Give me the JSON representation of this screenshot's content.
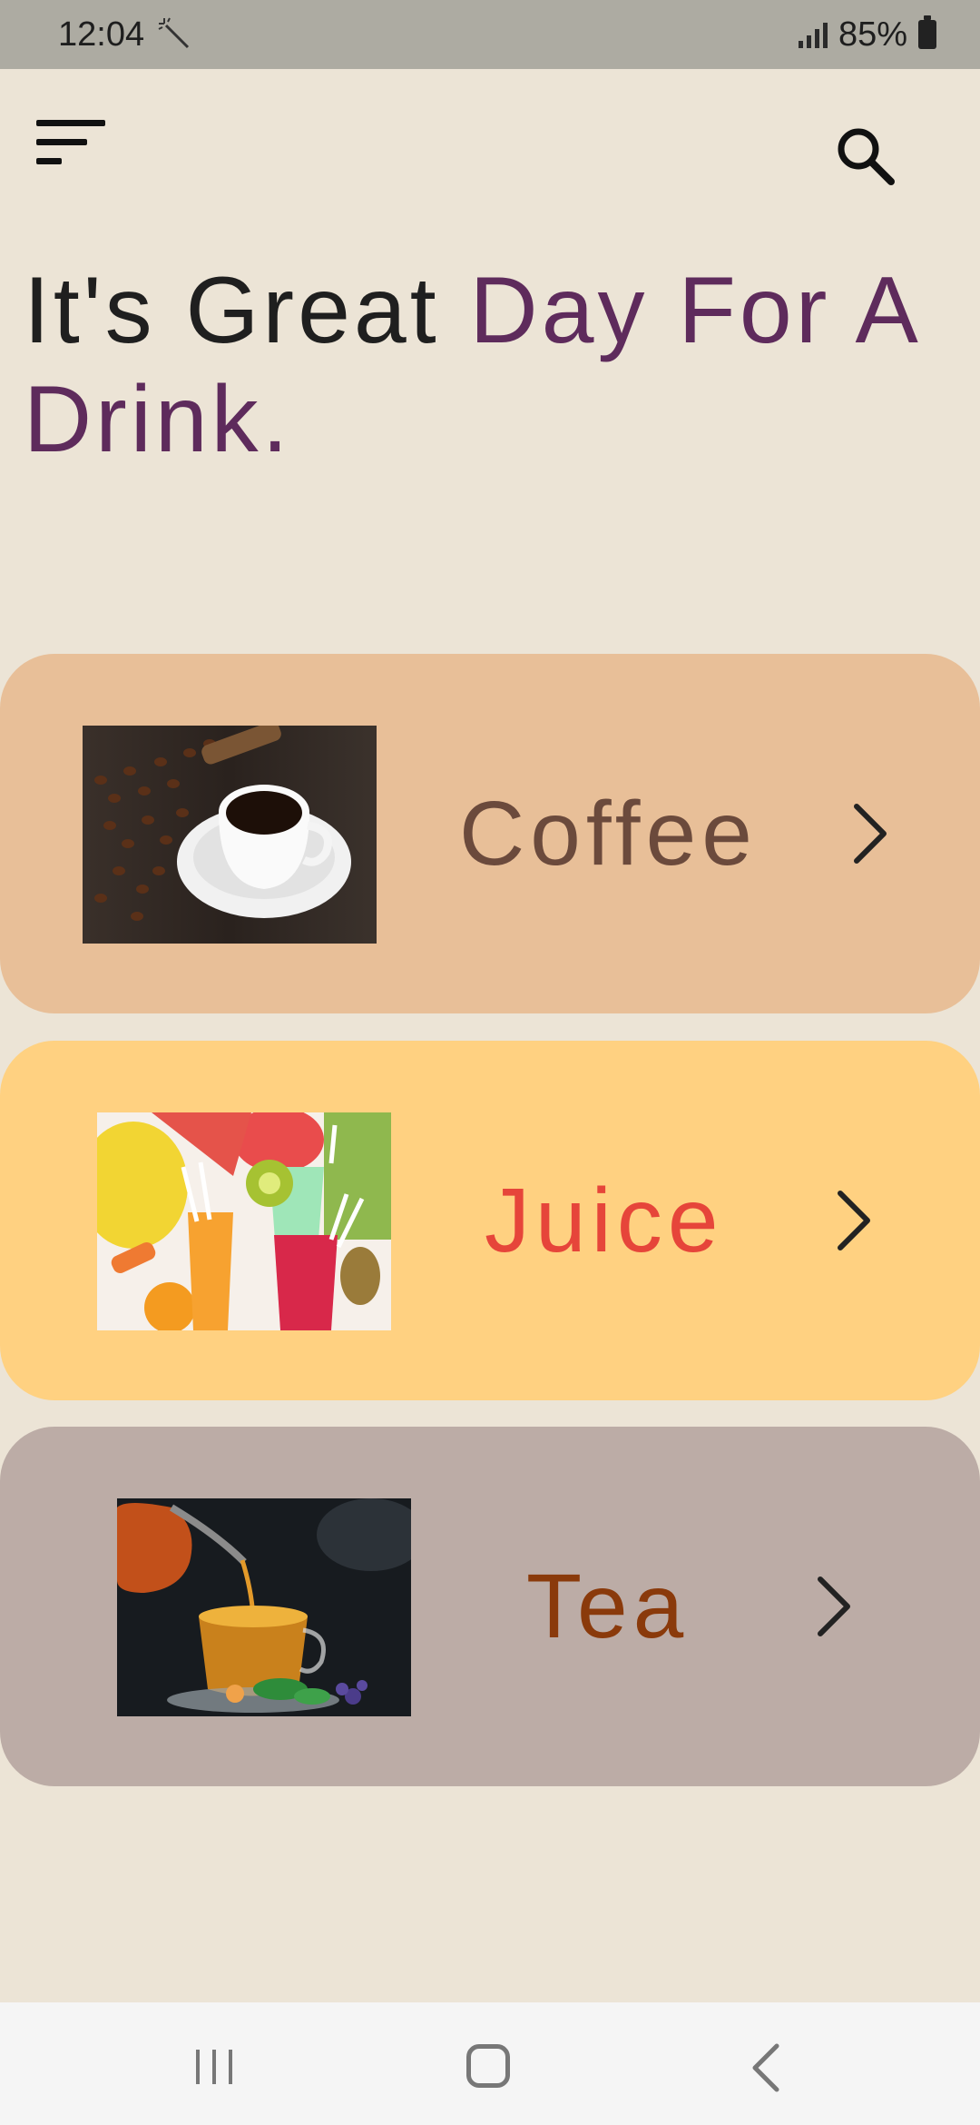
{
  "status_bar": {
    "time": "12:04",
    "battery": "85%"
  },
  "header": {
    "menu_icon": "filter-menu-icon",
    "search_icon": "search-icon"
  },
  "headline": {
    "part1": "It's Great ",
    "part2": "Day For A Drink.",
    "accent_color": "#5e2b5c"
  },
  "categories": [
    {
      "label": "Coffee",
      "image": "coffee-cup-beans-photo",
      "card_color": "#e8bf98",
      "text_color": "#6b4a3c"
    },
    {
      "label": "Juice",
      "image": "fruit-juice-glasses-photo",
      "card_color": "#ffd181",
      "text_color": "#e6453a"
    },
    {
      "label": "Tea",
      "image": "tea-pouring-photo",
      "card_color": "#bcaca6",
      "text_color": "#8a3a0b"
    }
  ],
  "nav_bar": {
    "recents_icon": "recents-icon",
    "home_icon": "home-icon",
    "back_icon": "back-icon"
  }
}
